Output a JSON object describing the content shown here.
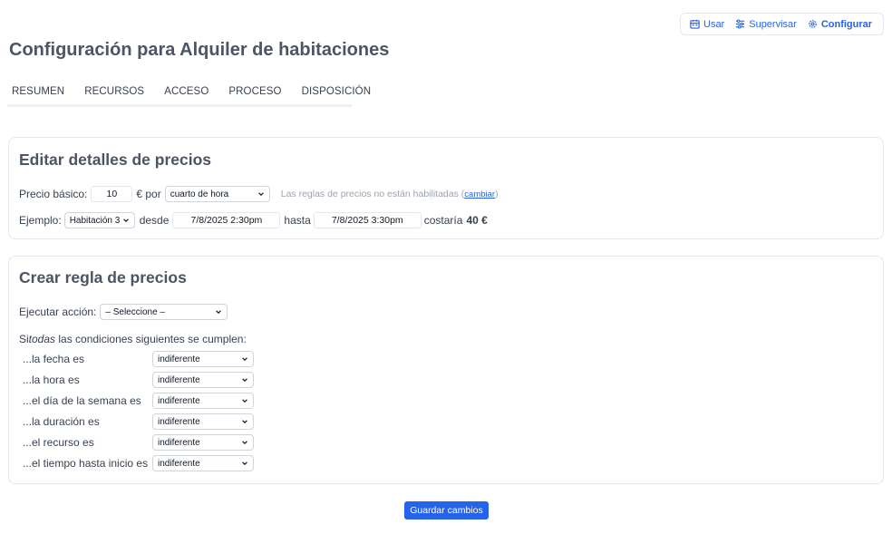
{
  "topnav": {
    "items": [
      {
        "label": "Usar",
        "icon": "calendar-icon"
      },
      {
        "label": "Supervisar",
        "icon": "sliders-icon"
      },
      {
        "label": "Configurar",
        "icon": "gear-icon"
      }
    ],
    "active": "Configurar",
    "color": "#2563eb"
  },
  "page": {
    "title": "Configuración para Alquiler de habitaciones"
  },
  "tabs": [
    "RESUMEN",
    "RECURSOS",
    "ACCESO",
    "PROCESO",
    "DISPOSICIÓN"
  ],
  "pricing": {
    "title": "Editar detalles de precios",
    "base_label": "Precio básico:",
    "base_value": "10",
    "per_label": "€ por",
    "unit_value": "cuarto de hora",
    "rules_note": "Las reglas de precios no están habilitadas (",
    "rules_link": "cambiar",
    "rules_note_end": ")",
    "example_label": "Ejemplo:",
    "example_room": "Habitación 3",
    "from_label": "desde",
    "from_value": "7/8/2025 2:30pm",
    "to_label": "hasta",
    "to_value": "7/8/2025 3:30pm",
    "cost_label": "costaría",
    "cost_value": "40 €"
  },
  "rule": {
    "title": "Crear regla de precios",
    "action_label": "Ejecutar acción:",
    "action_value": "– Seleccione –",
    "intro_prefix": "Si ",
    "intro_emph": "todas",
    "intro_suffix": " las condiciones siguientes se cumplen:",
    "conditions": [
      {
        "label": "...la fecha es",
        "value": "indiferente"
      },
      {
        "label": "...la hora es",
        "value": "indiferente"
      },
      {
        "label": "...el día de la semana es",
        "value": "indiferente"
      },
      {
        "label": "...la duración es",
        "value": "indiferente"
      },
      {
        "label": "...el recurso es",
        "value": "indiferente"
      },
      {
        "label": "...el tiempo hasta inicio es",
        "value": "indiferente"
      }
    ]
  },
  "save_label": "Guardar cambios"
}
